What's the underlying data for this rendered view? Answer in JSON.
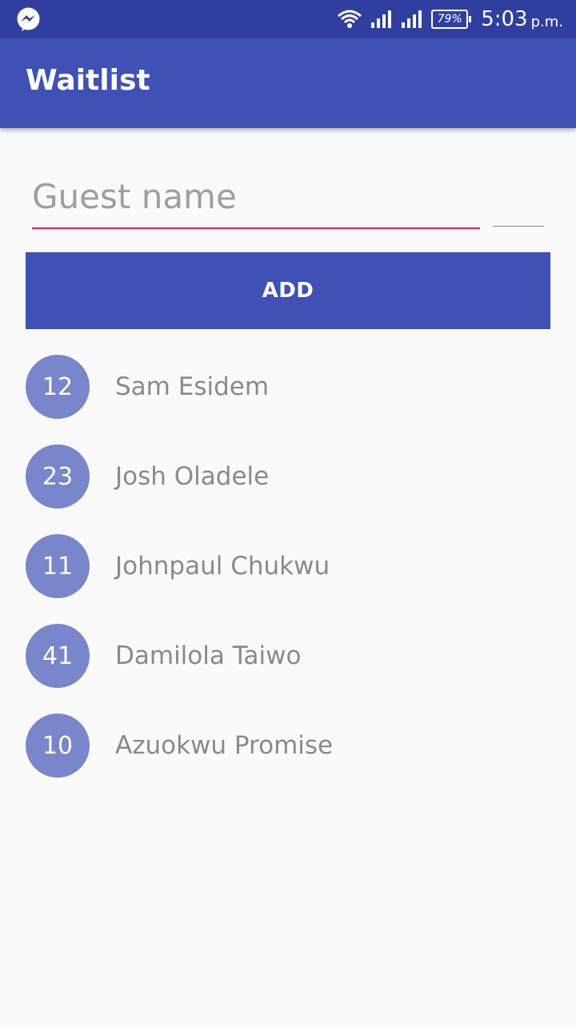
{
  "status_bar": {
    "battery": "79%",
    "time": "5:03",
    "ampm": "p.m."
  },
  "app_bar": {
    "title": "Waitlist"
  },
  "form": {
    "guest_name_placeholder": "Guest name",
    "add_label": "ADD"
  },
  "guests": [
    {
      "party_size": "12",
      "name": "Sam Esidem"
    },
    {
      "party_size": "23",
      "name": "Josh Oladele"
    },
    {
      "party_size": "11",
      "name": "Johnpaul Chukwu"
    },
    {
      "party_size": "41",
      "name": "Damilola Taiwo"
    },
    {
      "party_size": "10",
      "name": "Azuokwu Promise"
    }
  ],
  "colors": {
    "primary": "#3f51b5",
    "primary_dark": "#303f9f",
    "accent": "#e91e63",
    "badge": "#7986cb"
  }
}
